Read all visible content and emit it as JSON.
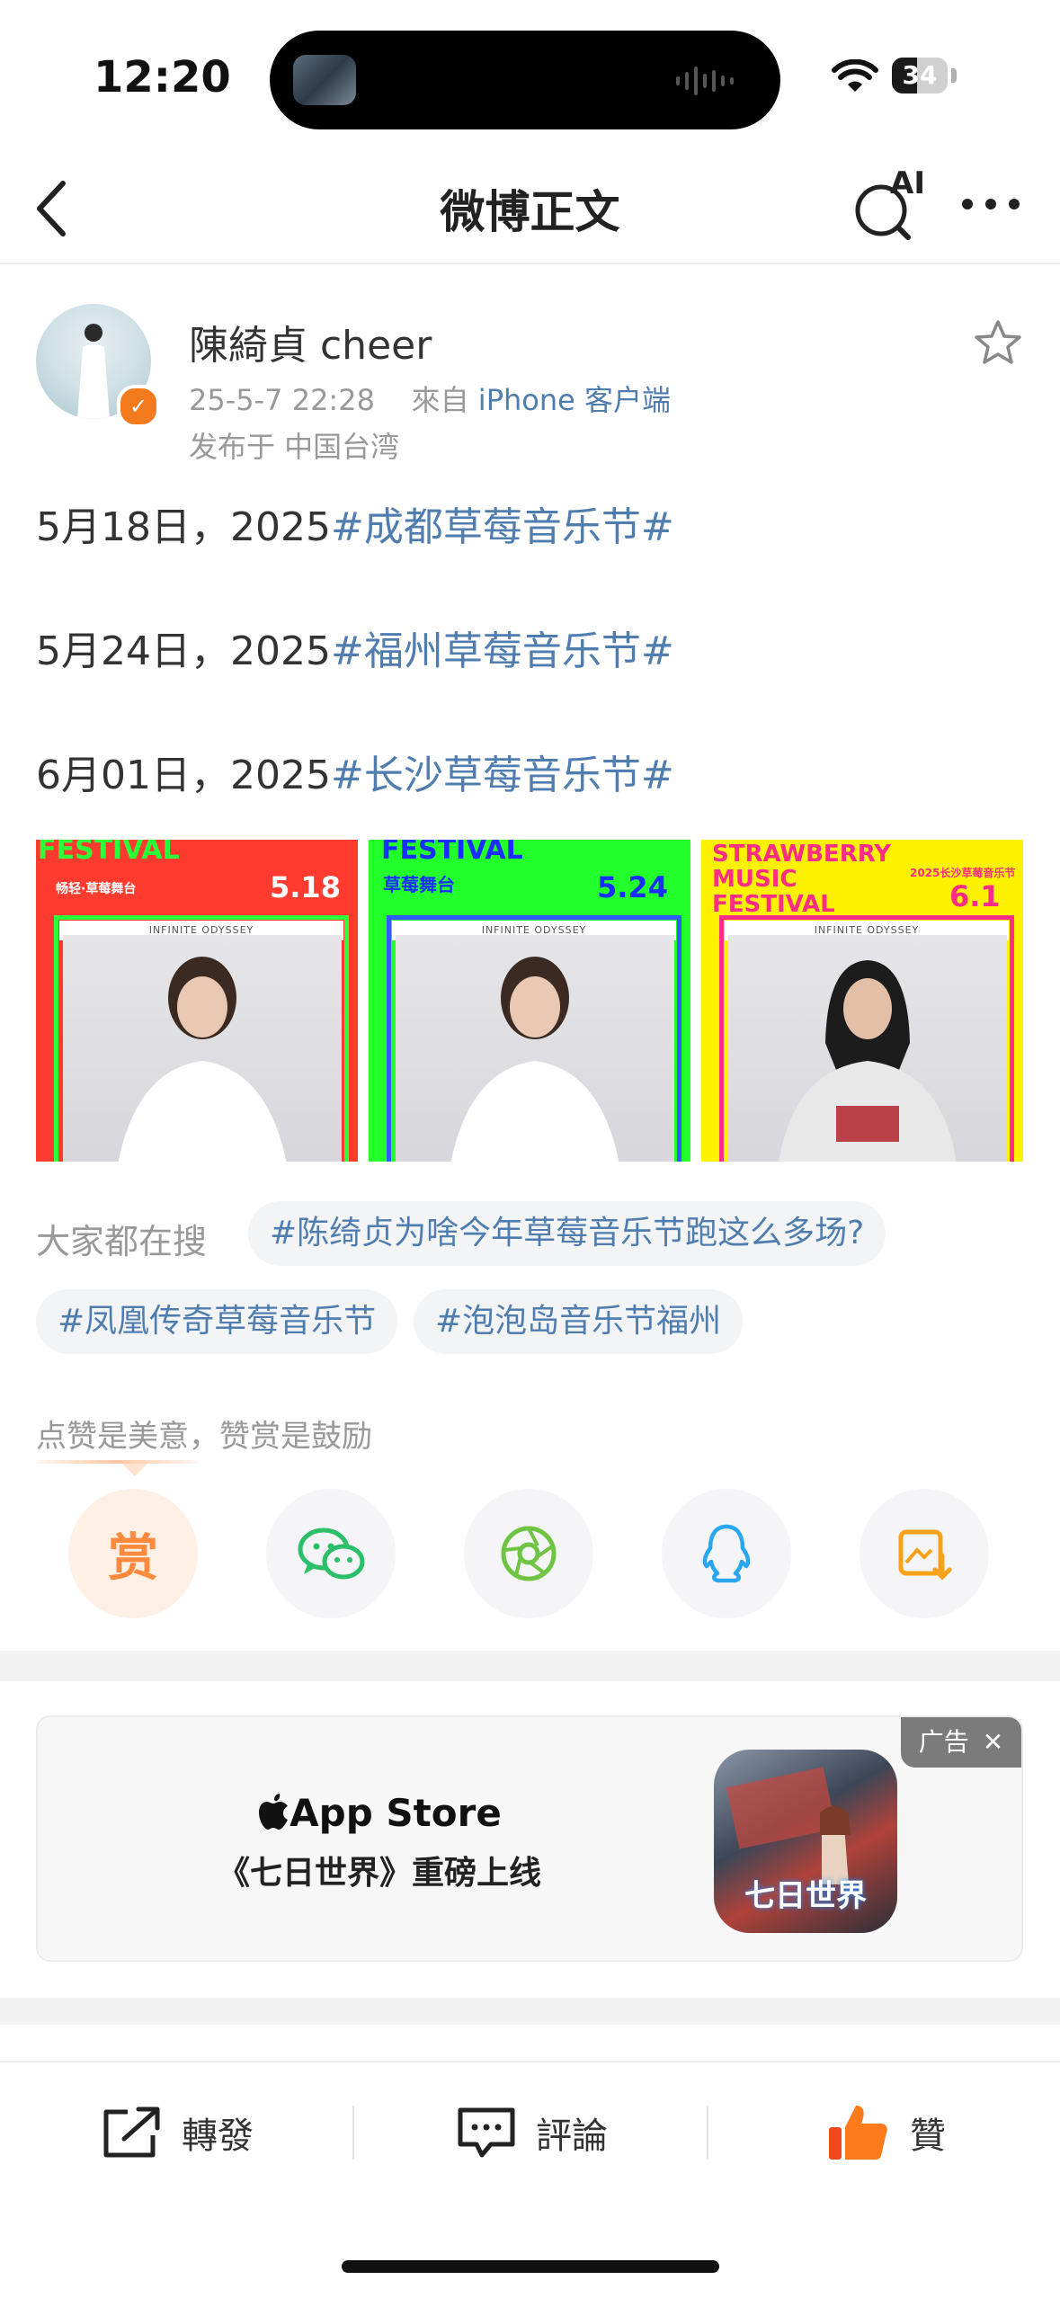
{
  "status_bar": {
    "time": "12:20",
    "battery": "34"
  },
  "nav": {
    "title": "微博正文",
    "ai_label": "AI"
  },
  "post": {
    "username": "陳綺貞 cheer",
    "timestamp": "25-5-7 22:28",
    "source_prefix": "來自",
    "source_device": "iPhone 客户端",
    "location": "发布于 中国台湾",
    "lines": [
      {
        "date": "5月18日，2025",
        "tag": "#成都草莓音乐节#"
      },
      {
        "date": "5月24日，2025",
        "tag": "#福州草莓音乐节#"
      },
      {
        "date": "6月01日，2025",
        "tag": "#长沙草莓音乐节#"
      }
    ],
    "images": [
      {
        "top_text": "FESTIVAL",
        "stage": "畅轻·草莓舞台",
        "date": "5.18",
        "bar": "INFINITE ODYSSEY",
        "bg": "#ff3b2f",
        "frame": "#2aff3a"
      },
      {
        "top_text": "FESTIVAL",
        "stage": "草莓舞台",
        "date": "5.24",
        "bar": "INFINITE ODYSSEY",
        "bg": "#22ff2a",
        "frame": "#2f5bff"
      },
      {
        "top_text": "STRAWBERRY MUSIC FESTIVAL",
        "stage": "2025长沙草莓音乐节",
        "date": "6.1",
        "bar": "INFINITE ODYSSEY",
        "bg": "#fff200",
        "frame": "#ff2d86"
      }
    ]
  },
  "search": {
    "label": "大家都在搜",
    "topics": [
      "#陈绮贞为啥今年草莓音乐节跑这么多场?",
      "#凤凰传奇草莓音乐节",
      "#泡泡岛音乐节福州"
    ]
  },
  "reward": {
    "prompt": "点赞是美意，赞赏是鼓励",
    "reward_char": "赏"
  },
  "ad": {
    "store": "App Store",
    "headline": "《七日世界》重磅上线",
    "badge": "广告",
    "icon_text": "七日世界"
  },
  "actions": {
    "repost": "轉發",
    "comment": "評論",
    "like": "贊"
  },
  "colors": {
    "link": "#507daf",
    "accent": "#ff8a3d"
  }
}
